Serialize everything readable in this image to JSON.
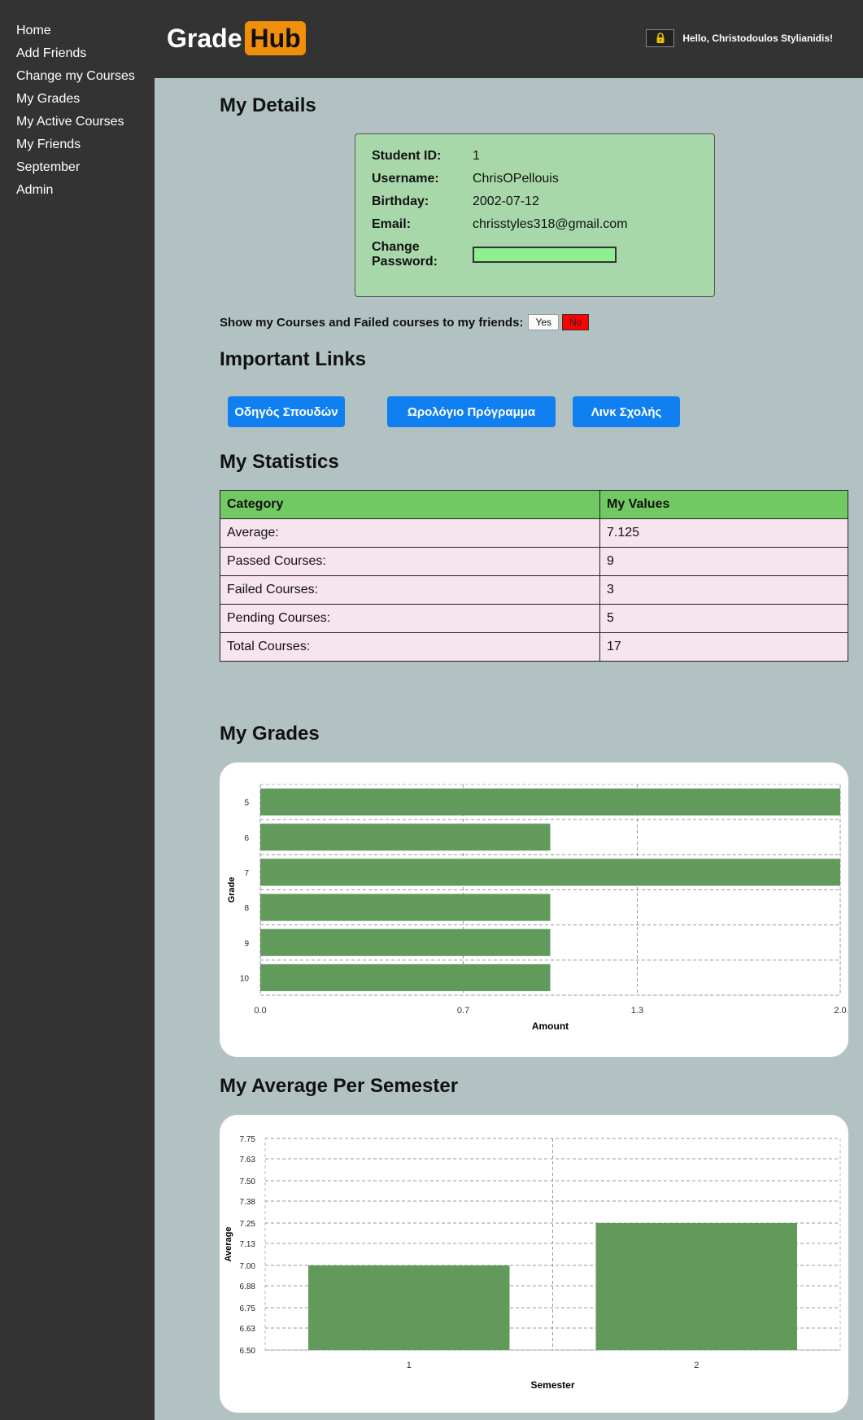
{
  "nav": [
    "Home",
    "Add Friends",
    "Change my Courses",
    "My Grades",
    "My Active Courses",
    "My Friends",
    "September",
    "Admin"
  ],
  "header": {
    "logo_left": "Grade",
    "logo_right": "Hub",
    "greeting": "Hello, Christodoulos Stylianidis!",
    "lock_icon": "lock-icon"
  },
  "details": {
    "title": "My Details",
    "student_id_label": "Student ID:",
    "student_id": "1",
    "username_label": "Username:",
    "username": "ChrisOPellouis",
    "birthday_label": "Birthday:",
    "birthday": "2002-07-12",
    "email_label": "Email:",
    "email": "chrisstyles318@gmail.com",
    "password_label": "Change Password:"
  },
  "privacy": {
    "label": "Show my Courses and Failed courses to my friends:",
    "yes": "Yes",
    "no": "No"
  },
  "links": {
    "title": "Important Links",
    "items": [
      "Οδηγός Σπουδών",
      "Ωρολόγιο Πρόγραμμα",
      "Λινκ Σχολής"
    ]
  },
  "stats": {
    "title": "My Statistics",
    "headers": [
      "Category",
      "My Values"
    ],
    "rows": [
      [
        "Average:",
        "7.125"
      ],
      [
        "Passed Courses:",
        "9"
      ],
      [
        "Failed Courses:",
        "3"
      ],
      [
        "Pending Courses:",
        "5"
      ],
      [
        "Total Courses:",
        "17"
      ]
    ]
  },
  "grades_title": "My Grades",
  "semester_title": "My Average Per Semester",
  "colors": {
    "bar": "#629a5c",
    "accent": "#f0900a",
    "button": "#1080f0"
  },
  "chart_data": [
    {
      "type": "bar",
      "orientation": "horizontal",
      "categories": [
        "5",
        "6",
        "7",
        "8",
        "9",
        "10"
      ],
      "values": [
        2,
        1,
        2,
        1,
        1,
        1
      ],
      "xlabel": "Amount",
      "ylabel": "Grade",
      "xlim": [
        0,
        2
      ],
      "xticks": [
        "0.0",
        "0.7",
        "1.3",
        "2.0"
      ],
      "grid": true
    },
    {
      "type": "bar",
      "orientation": "vertical",
      "categories": [
        "1",
        "2"
      ],
      "values": [
        7.0,
        7.25
      ],
      "xlabel": "Semester",
      "ylabel": "Average",
      "ylim": [
        6.5,
        7.75
      ],
      "yticks": [
        "6.50",
        "6.63",
        "6.75",
        "6.88",
        "7.00",
        "7.13",
        "7.25",
        "7.38",
        "7.50",
        "7.63",
        "7.75"
      ],
      "grid": true
    }
  ]
}
